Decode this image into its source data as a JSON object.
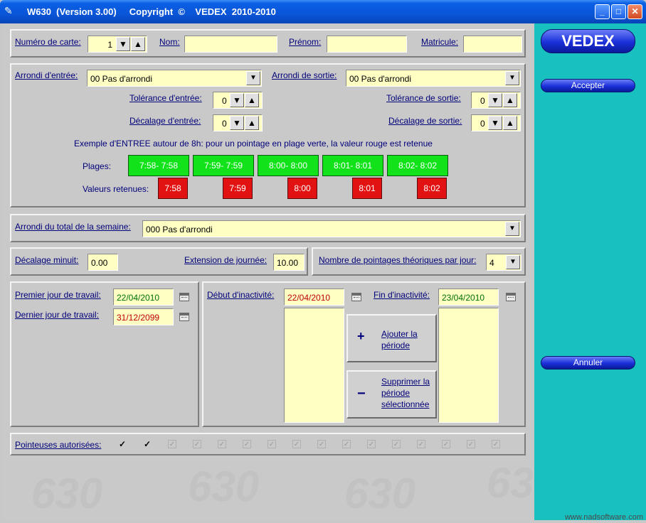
{
  "window": {
    "title": "W630  (Version 3.00)     Copyright  ©    VEDEX  2010-2010",
    "min": "_",
    "max": "□",
    "close": "✕"
  },
  "card": {
    "numero_label": "Numéro de carte:",
    "numero_value": "1",
    "nom_label": "Nom:",
    "nom_value": "",
    "prenom_label": "Prénom:",
    "prenom_value": "",
    "matricule_label": "Matricule:",
    "matricule_value": ""
  },
  "rounding": {
    "entry_label": "Arrondi d'entrée:",
    "entry_value": "00 Pas d'arrondi",
    "exit_label": "Arrondi de sortie:",
    "exit_value": "00 Pas d'arrondi",
    "tol_entry_label": "Tolérance d'entrée:",
    "tol_entry_value": "0",
    "tol_exit_label": "Tolérance de sortie:",
    "tol_exit_value": "0",
    "dec_entry_label": "Décalage d'entrée:",
    "dec_entry_value": "0",
    "dec_exit_label": "Décalage de sortie:",
    "dec_exit_value": "0",
    "example_text": "Exemple d'ENTREE autour de 8h: pour un pointage en plage verte, la valeur rouge est retenue",
    "plages_label": "Plages:",
    "valeurs_label": "Valeurs retenues:",
    "plages": [
      "7:58- 7:58",
      "7:59- 7:59",
      "8:00- 8:00",
      "8:01- 8:01",
      "8:02- 8:02"
    ],
    "valeurs": [
      "7:58",
      "7:59",
      "8:00",
      "8:01",
      "8:02"
    ]
  },
  "week": {
    "label": "Arrondi du total de la semaine:",
    "value": "000 Pas d'arrondi"
  },
  "misc": {
    "dec_minuit_label": "Décalage minuit:",
    "dec_minuit_value": "0.00",
    "extension_label": "Extension de journée:",
    "extension_value": "10.00",
    "nb_pointages_label": "Nombre de pointages théoriques par jour:",
    "nb_pointages_value": "4"
  },
  "work": {
    "premier_label": "Premier jour de travail:",
    "premier_value": "22/04/2010",
    "dernier_label": "Dernier jour de travail:",
    "dernier_value": "31/12/2099"
  },
  "inactivity": {
    "debut_label": "Début d'inactivité:",
    "debut_value": "22/04/2010",
    "fin_label": "Fin d'inactivité:",
    "fin_value": "23/04/2010",
    "add_label": "Ajouter la période",
    "add_symbol": "+",
    "remove_label": "Supprimer la période sélectionnée",
    "remove_symbol": "−"
  },
  "pointeuses": {
    "label": "Pointeuses autorisées:",
    "checks": [
      true,
      true,
      false,
      false,
      false,
      false,
      false,
      false,
      false,
      false,
      false,
      false,
      false,
      false,
      false,
      false
    ]
  },
  "side": {
    "brand": "VEDEX",
    "accept": "Accepter",
    "cancel": "Annuler",
    "watermark": "www.nadsoftware.com"
  },
  "icons": {
    "down": "▼",
    "up": "▲",
    "check": "✓"
  }
}
